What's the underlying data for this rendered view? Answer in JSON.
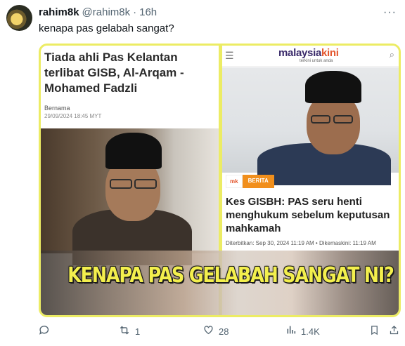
{
  "tweet": {
    "display_name": "rahim8k",
    "handle": "@rahim8k",
    "separator": "·",
    "time": "16h",
    "text": "kenapa pas gelabah sangat?"
  },
  "media": {
    "border_color": "#ecec64",
    "left": {
      "headline": "Tiada ahli Pas Kelantan terlibat GISB, Al-Arqam - Mohamed Fadzli",
      "source": "Bernama",
      "date": "29/09/2024 18:45 MYT"
    },
    "right": {
      "logo_main": "malaysia",
      "logo_accent": "kini",
      "tagline": "terkini untuk anda",
      "badge_site": "mk",
      "badge_category": "BERITA",
      "headline": "Kes GISBH: PAS seru henti menghukum sebelum keputusan mahkamah",
      "meta": "Diterbitkan:  Sep 30, 2024 11:19 AM  •  Dikemaskini: 11:19 AM"
    },
    "caption": "KENAPA PAS GELABAH SANGAT NI?"
  },
  "actions": {
    "reply": {
      "icon": "reply-icon",
      "count": ""
    },
    "retweet": {
      "icon": "retweet-icon",
      "count": "1"
    },
    "like": {
      "icon": "heart-icon",
      "count": "28"
    },
    "views": {
      "icon": "views-icon",
      "count": "1.4K"
    },
    "bookmark": {
      "icon": "bookmark-icon"
    },
    "share": {
      "icon": "share-icon"
    }
  }
}
